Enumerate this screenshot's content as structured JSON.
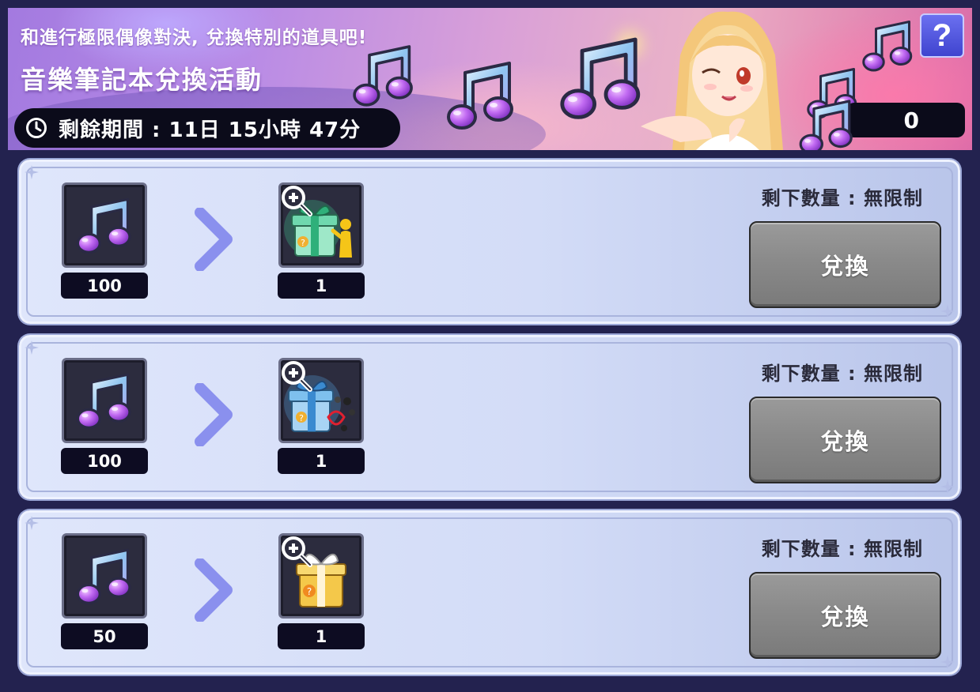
{
  "banner": {
    "subtitle": "和進行極限偶像對決, 兌換特別的道具吧!",
    "title": "音樂筆記本兌換活動",
    "timer_text": "剩餘期間 : 11日 15小時 47分",
    "help_label": "?",
    "currency_count": "0"
  },
  "rows": [
    {
      "cost": "100",
      "reward_count": "1",
      "remaining": "剩下數量 : 無限制",
      "button": "兌換",
      "reward_icon": "green-gift-box-with-figure-icon"
    },
    {
      "cost": "100",
      "reward_count": "1",
      "remaining": "剩下數量 : 無限制",
      "button": "兌換",
      "reward_icon": "blue-gift-box-with-accessories-icon"
    },
    {
      "cost": "50",
      "reward_count": "1",
      "remaining": "剩下數量 : 無限制",
      "button": "兌換",
      "reward_icon": "gold-gift-box-icon"
    }
  ],
  "colors": {
    "background": "#23224f",
    "row_panel": "#d3dcf7",
    "button_disabled": "#8a8a8a",
    "arrow": "#8a90ee",
    "note_purple": "#b45cf0"
  }
}
